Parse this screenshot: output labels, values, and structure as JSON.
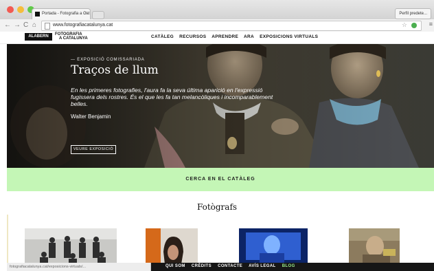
{
  "browser": {
    "tab_title": "Portada - Fotografia a Cat",
    "url": "www.fotografiacatalunya.cat",
    "profile": "Perfil predete..."
  },
  "site": {
    "logo": "ALABERN",
    "logo_line1": "FOTOGRAFIA",
    "logo_line2": "A CATALUNYA",
    "nav": [
      "CATÀLEG",
      "RECURSOS",
      "APRENDRE",
      "ARA",
      "EXPOSICIONS VIRTUALS"
    ]
  },
  "hero": {
    "kicker": "— EXPOSICIÓ COMISSARIADA",
    "title": "Traços de llum",
    "quote": "En les primeres fotografies, l'aura fa la seva última aparició en l'expressió fugissera dels rostres. És el que les fa tan melancòliques i incomparablement belles.",
    "author": "Walter Benjamin",
    "button": "VEURE EXPOSICIÓ"
  },
  "search_band": {
    "label": "CERCA EN EL CATÀLEG"
  },
  "photographers": {
    "title": "Fotògrafs"
  },
  "footer": {
    "status": "fotografiacatalunya.cat/exposicions-virtuals/...",
    "links": [
      "QUI SOM",
      "CRÈDITS",
      "CONTACTE",
      "AVÍS LEGAL",
      "BLOG"
    ]
  },
  "colors": {
    "accent": "#c4f6b6",
    "blog_link": "#9bf08d",
    "dark": "#161616"
  }
}
